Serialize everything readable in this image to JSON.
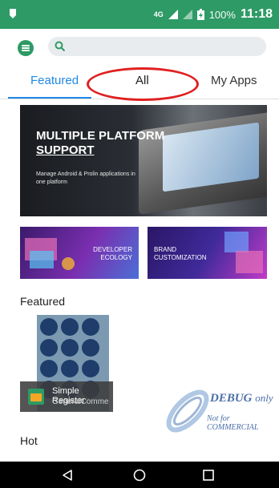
{
  "status_bar": {
    "network": "4G",
    "battery": "100%",
    "time": "11:18"
  },
  "search": {
    "placeholder": ""
  },
  "tabs": [
    {
      "label": "Featured"
    },
    {
      "label": "All"
    },
    {
      "label": "My Apps"
    }
  ],
  "banner": {
    "title_line1": "MULTIPLE PLATFORM",
    "title_line2": "SUPPORT",
    "subtitle": "Manage Android & Prolin applications in one platform"
  },
  "promos": [
    {
      "line1": "DEVELOPER",
      "line2": "ECOLOGY"
    },
    {
      "line1": "BRAND",
      "line2": "CUSTOMIZATION"
    }
  ],
  "sections": {
    "featured": "Featured",
    "hot": "Hot"
  },
  "featured_app": {
    "name": "Simple Register",
    "developer": "GeneralComme"
  },
  "watermark": {
    "debug": "DEBUG",
    "only": "only",
    "note": "Not for COMMERCIAL"
  },
  "colors": {
    "accent_green": "#2e9a66",
    "tab_active": "#1e88e5",
    "annotation_red": "#e02020"
  }
}
